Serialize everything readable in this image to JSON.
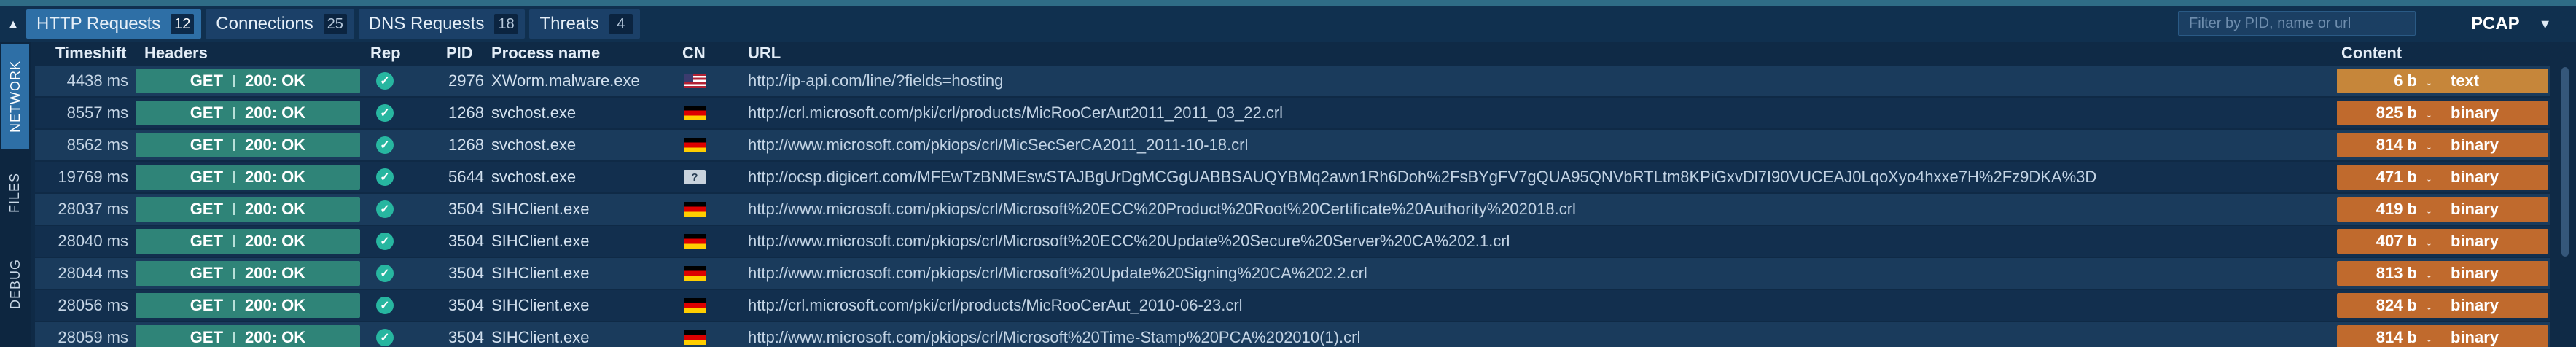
{
  "tabs": [
    {
      "label": "HTTP Requests",
      "count": "12"
    },
    {
      "label": "Connections",
      "count": "25"
    },
    {
      "label": "DNS Requests",
      "count": "18"
    },
    {
      "label": "Threats",
      "count": "4"
    }
  ],
  "filter": {
    "placeholder": "Filter by PID, name or url"
  },
  "pcap_label": "PCAP",
  "sidenav": {
    "network": "NETWORK",
    "files": "FILES",
    "debug": "DEBUG"
  },
  "columns": {
    "timeshift": "Timeshift",
    "headers": "Headers",
    "rep": "Rep",
    "pid": "PID",
    "process": "Process name",
    "cn": "CN",
    "url": "URL",
    "content": "Content"
  },
  "rows": [
    {
      "time": "4438 ms",
      "method": "GET",
      "status": "200: OK",
      "pid": "2976",
      "process": "XWorm.malware.exe",
      "cn": "us",
      "url": "http://ip-api.com/line/?fields=hosting",
      "size": "6 b",
      "type": "text"
    },
    {
      "time": "8557 ms",
      "method": "GET",
      "status": "200: OK",
      "pid": "1268",
      "process": "svchost.exe",
      "cn": "de",
      "url": "http://crl.microsoft.com/pki/crl/products/MicRooCerAut2011_2011_03_22.crl",
      "size": "825 b",
      "type": "binary"
    },
    {
      "time": "8562 ms",
      "method": "GET",
      "status": "200: OK",
      "pid": "1268",
      "process": "svchost.exe",
      "cn": "de",
      "url": "http://www.microsoft.com/pkiops/crl/MicSecSerCA2011_2011-10-18.crl",
      "size": "814 b",
      "type": "binary"
    },
    {
      "time": "19769 ms",
      "method": "GET",
      "status": "200: OK",
      "pid": "5644",
      "process": "svchost.exe",
      "cn": "unknown",
      "url": "http://ocsp.digicert.com/MFEwTzBNMEswSTAJBgUrDgMCGgUABBSAUQYBMq2awn1Rh6Doh%2FsBYgFV7gQUA95QNVbRTLtm8KPiGxvDl7I90VUCEAJ0LqoXyo4hxxe7H%2Fz9DKA%3D",
      "size": "471 b",
      "type": "binary"
    },
    {
      "time": "28037 ms",
      "method": "GET",
      "status": "200: OK",
      "pid": "3504",
      "process": "SIHClient.exe",
      "cn": "de",
      "url": "http://www.microsoft.com/pkiops/crl/Microsoft%20ECC%20Product%20Root%20Certificate%20Authority%202018.crl",
      "size": "419 b",
      "type": "binary"
    },
    {
      "time": "28040 ms",
      "method": "GET",
      "status": "200: OK",
      "pid": "3504",
      "process": "SIHClient.exe",
      "cn": "de",
      "url": "http://www.microsoft.com/pkiops/crl/Microsoft%20ECC%20Update%20Secure%20Server%20CA%202.1.crl",
      "size": "407 b",
      "type": "binary"
    },
    {
      "time": "28044 ms",
      "method": "GET",
      "status": "200: OK",
      "pid": "3504",
      "process": "SIHClient.exe",
      "cn": "de",
      "url": "http://www.microsoft.com/pkiops/crl/Microsoft%20Update%20Signing%20CA%202.2.crl",
      "size": "813 b",
      "type": "binary"
    },
    {
      "time": "28056 ms",
      "method": "GET",
      "status": "200: OK",
      "pid": "3504",
      "process": "SIHClient.exe",
      "cn": "de",
      "url": "http://crl.microsoft.com/pki/crl/products/MicRooCerAut_2010-06-23.crl",
      "size": "824 b",
      "type": "binary"
    },
    {
      "time": "28059 ms",
      "method": "GET",
      "status": "200: OK",
      "pid": "3504",
      "process": "SIHClient.exe",
      "cn": "de",
      "url": "http://www.microsoft.com/pkiops/crl/Microsoft%20Time-Stamp%20PCA%202010(1).crl",
      "size": "814 b",
      "type": "binary"
    }
  ]
}
